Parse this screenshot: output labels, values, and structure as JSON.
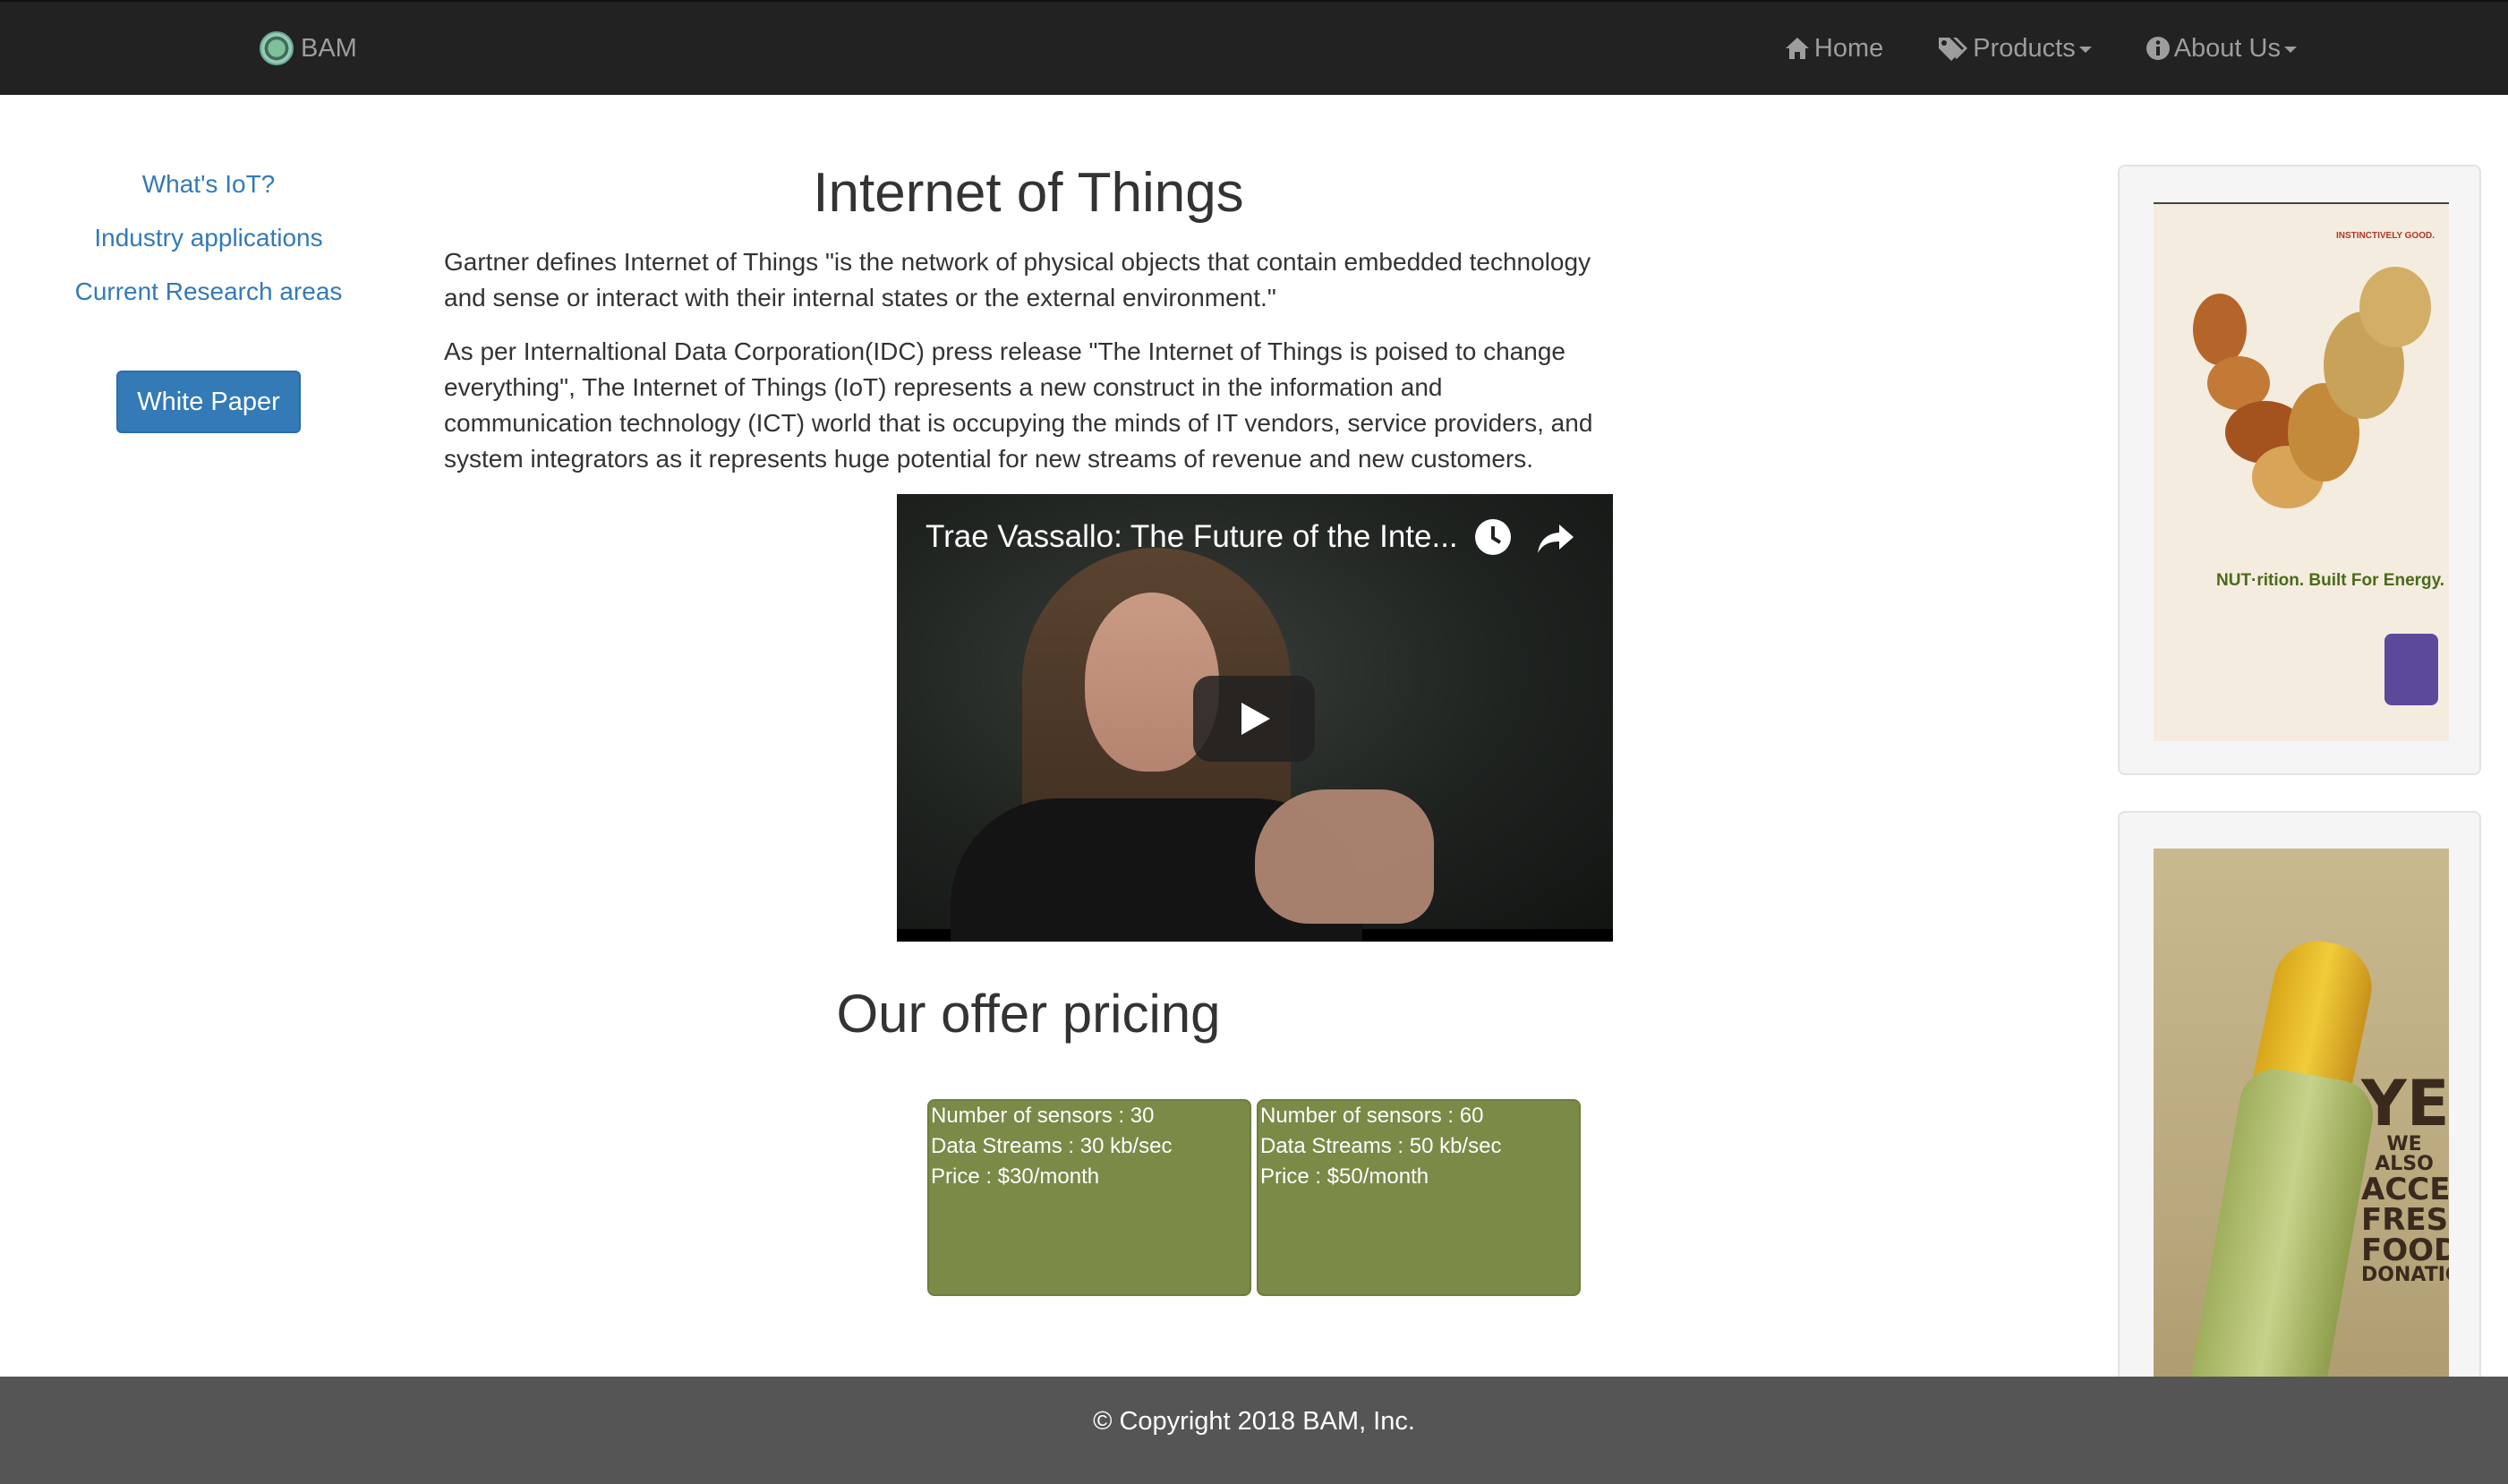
{
  "navbar": {
    "brand": "BAM",
    "items": [
      {
        "label": "Home",
        "icon": "home-icon"
      },
      {
        "label": "Products",
        "icon": "tags-icon",
        "dropdown": true
      },
      {
        "label": "About Us",
        "icon": "info-icon",
        "dropdown": true
      }
    ]
  },
  "sidebar": {
    "links": [
      "What's IoT?",
      "Industry applications",
      "Current Research areas"
    ],
    "button": "White Paper"
  },
  "main": {
    "title": "Internet of Things",
    "paragraphs": [
      "Gartner defines Internet of Things \"is the network of physical objects that contain embedded technology and sense or interact with their internal states or the external environment.\"",
      "As per Internaltional Data Corporation(IDC) press release \"The Internet of Things is poised to change everything\", The Internet of Things (IoT) represents a new construct in the information and communication technology (ICT) world that is occupying the minds of IT vendors, service providers, and system integrators as it represents huge potential for new streams of revenue and new customers."
    ],
    "video": {
      "title": "Trae Vassallo: The Future of the Inte..."
    },
    "offer_title": "Our offer pricing",
    "offers": [
      {
        "sensors": "Number of sensors : 30",
        "streams": "Data Streams : 30 kb/sec",
        "price": "Price : $30/month"
      },
      {
        "sensors": "Number of sensors : 60",
        "streams": "Data Streams : 50 kb/sec",
        "price": "Price : $50/month"
      }
    ]
  },
  "ads": {
    "ad1": {
      "headline": "NUT·rition. Built For Energy.",
      "tag": "INSTINCTIVELY GOOD."
    },
    "ad2": {
      "line1": "YES",
      "line2": "WE ALSO",
      "line3": "ACCEPT",
      "line4": "FRESH",
      "line5": "FOOD",
      "line6": "DONATIONS"
    }
  },
  "footer": {
    "text": "© Copyright 2018 BAM, Inc."
  },
  "colors": {
    "navbar_bg": "#222222",
    "link": "#337ab7",
    "offer_card": "#7a8a47",
    "footer_bg": "#555555"
  }
}
